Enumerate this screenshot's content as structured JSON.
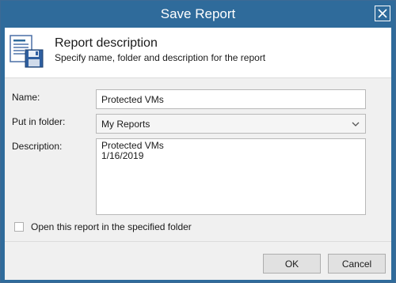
{
  "window": {
    "title": "Save Report"
  },
  "header": {
    "icon": "report-save-icon",
    "title": "Report description",
    "subtitle": "Specify name, folder and description for the report"
  },
  "form": {
    "name_label": "Name:",
    "name_value": "Protected VMs",
    "folder_label": "Put in folder:",
    "folder_value": "My Reports",
    "description_label": "Description:",
    "description_lines": [
      "Protected VMs",
      "1/16/2019"
    ],
    "open_checkbox_label": "Open this report in the specified folder",
    "open_checkbox_checked": false
  },
  "buttons": {
    "ok": "OK",
    "cancel": "Cancel"
  },
  "colors": {
    "titlebar": "#2f6b9b",
    "dialog_bg": "#f0f0f0",
    "header_bg": "#ffffff"
  }
}
